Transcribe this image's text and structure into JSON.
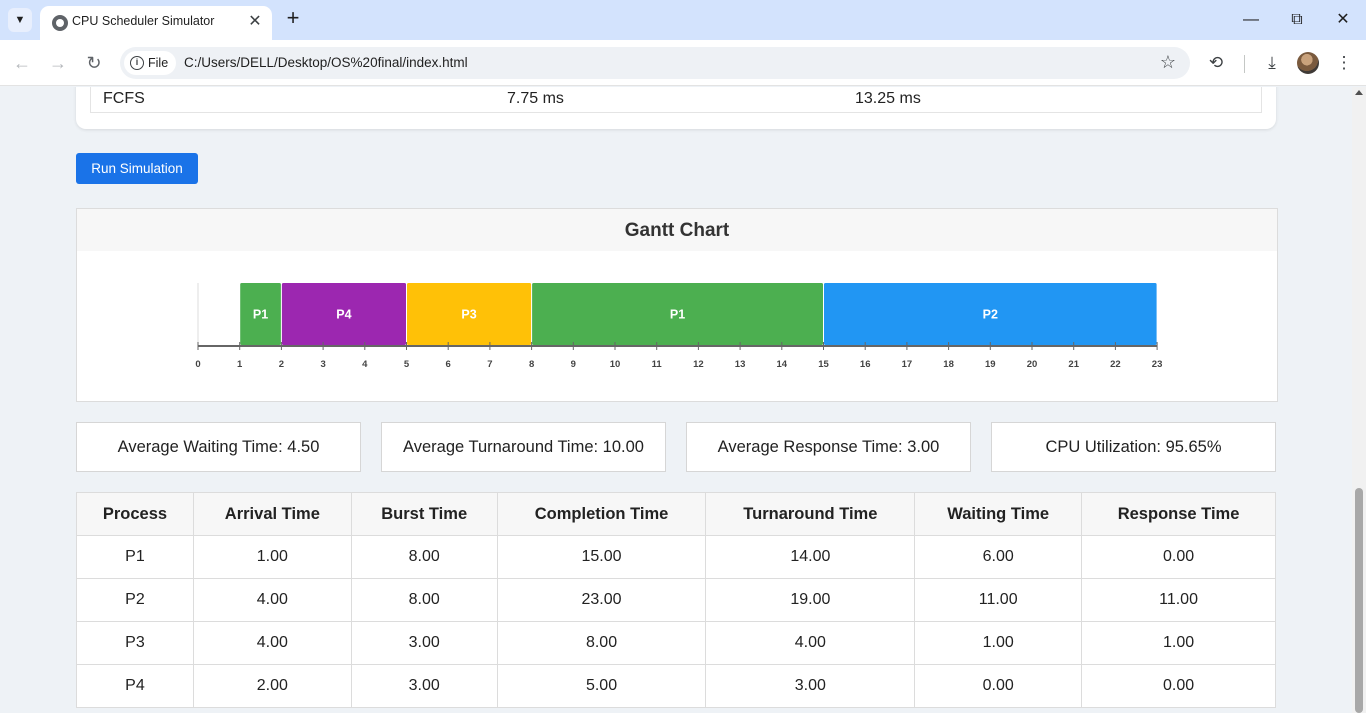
{
  "browser": {
    "tab_title": "CPU Scheduler Simulator",
    "tab_close": "✕",
    "new_tab": "+",
    "chip_label": "File",
    "url": "C:/Users/DELL/Desktop/OS%20final/index.html"
  },
  "comparison_row": {
    "algorithm": "FCFS",
    "value_1": "7.75 ms",
    "value_2": "13.25 ms"
  },
  "controls": {
    "run_label": "Run Simulation"
  },
  "gantt": {
    "title": "Gantt Chart",
    "segments": [
      {
        "process": "P1",
        "start": 1,
        "end": 2,
        "color": "#4caf50"
      },
      {
        "process": "P4",
        "start": 2,
        "end": 5,
        "color": "#9c27b0"
      },
      {
        "process": "P3",
        "start": 5,
        "end": 8,
        "color": "#ffc107"
      },
      {
        "process": "P1",
        "start": 8,
        "end": 15,
        "color": "#4caf50"
      },
      {
        "process": "P2",
        "start": 15,
        "end": 23,
        "color": "#2196f3"
      }
    ],
    "ticks": [
      "0",
      "1",
      "2",
      "3",
      "4",
      "5",
      "6",
      "7",
      "8",
      "9",
      "10",
      "11",
      "12",
      "13",
      "14",
      "15",
      "16",
      "17",
      "18",
      "19",
      "20",
      "21",
      "22",
      "23"
    ]
  },
  "stats": {
    "avg_waiting": "Average Waiting Time: 4.50",
    "avg_turnaround": "Average Turnaround Time: 10.00",
    "avg_response": "Average Response Time: 3.00",
    "cpu_utilization": "CPU Utilization: 95.65%"
  },
  "results": {
    "headers": [
      "Process",
      "Arrival Time",
      "Burst Time",
      "Completion Time",
      "Turnaround Time",
      "Waiting Time",
      "Response Time"
    ],
    "rows": [
      [
        "P1",
        "1.00",
        "8.00",
        "15.00",
        "14.00",
        "6.00",
        "0.00"
      ],
      [
        "P2",
        "4.00",
        "8.00",
        "23.00",
        "19.00",
        "11.00",
        "11.00"
      ],
      [
        "P3",
        "4.00",
        "3.00",
        "8.00",
        "4.00",
        "1.00",
        "1.00"
      ],
      [
        "P4",
        "2.00",
        "3.00",
        "5.00",
        "3.00",
        "0.00",
        "0.00"
      ]
    ]
  }
}
